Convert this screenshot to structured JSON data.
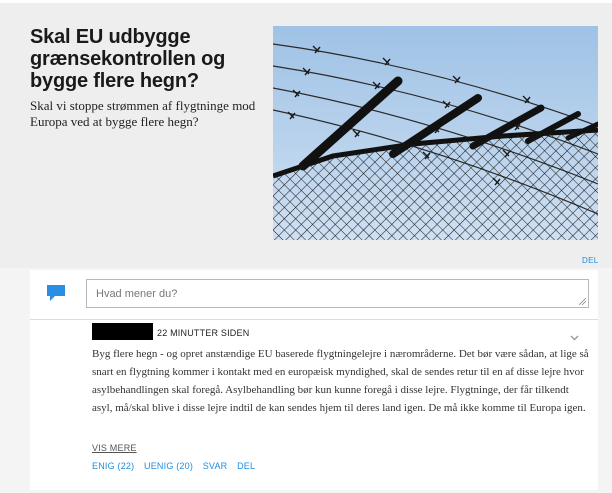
{
  "article": {
    "headline": "Skal EU udbygge grænsekontrollen og bygge flere hegn?",
    "subheadline": "Skal vi stoppe strømmen af flygtninge mod Europa ved at bygge flere hegn?",
    "image_icon": "barbed-wire-fence-photo"
  },
  "share_label": "DEL",
  "composer": {
    "icon": "speech-bubble-icon",
    "placeholder": "Hvad mener du?"
  },
  "comment": {
    "timestamp": "22 MINUTTER SIDEN",
    "text": "Byg flere hegn - og opret anstændige EU baserede flygtningelejre i nærområderne. Det bør være sådan, at lige så snart en flygtning kommer i kontakt med en europæisk myndighed, skal de sendes retur til en af disse lejre hvor asylbehandlingen skal foregå. Asylbehandling bør kun kunne foregå i disse lejre. Flygtninge, der får tilkendt asyl, må/skal blive i disse lejre indtil de kan sendes hjem til deres land igen. De må ikke komme til Europa igen.",
    "show_more": "VIS MERE",
    "actions": {
      "agree": "ENIG (22)",
      "disagree": "UENIG (20)",
      "reply": "SVAR",
      "share": "DEL"
    }
  },
  "colors": {
    "accent": "#1e8ee0",
    "sky": "#a8c8ea",
    "panel": "#eeeeee"
  }
}
